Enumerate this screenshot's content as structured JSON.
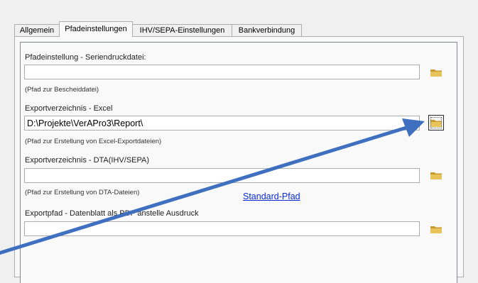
{
  "tabs": [
    {
      "label": "Allgemein"
    },
    {
      "label": "Pfadeinstellungen"
    },
    {
      "label": "IHV/SEPA-Einstellungen"
    },
    {
      "label": "Bankverbindung"
    }
  ],
  "active_tab": "Pfadeinstellungen",
  "sections": [
    {
      "label": "Pfadeinstellung - Seriendruckdatei:",
      "value": "",
      "hint": "(Pfad zur Bescheiddatei)"
    },
    {
      "label": "Exportverzeichnis - Excel",
      "value": "D:\\Projekte\\VerAPro3\\Report\\",
      "hint": "(Pfad zur Erstellung von Excel-Exportdateien)"
    },
    {
      "label": "Exportverzeichnis - DTA(IHV/SEPA)",
      "value": "",
      "hint": "(Pfad zur Erstellung von DTA-Dateien)"
    },
    {
      "label": "Exportpfad - Datenblatt als PDF anstelle Ausdruck",
      "value": "",
      "hint": ""
    }
  ],
  "standard_path_link": "Standard-Pfad",
  "icons": {
    "folder": "folder-icon",
    "arrow": "annotation-arrow"
  },
  "colors": {
    "arrow": "#3f6fbf",
    "link": "#0b2bdb",
    "folder": "#d9b44a"
  }
}
